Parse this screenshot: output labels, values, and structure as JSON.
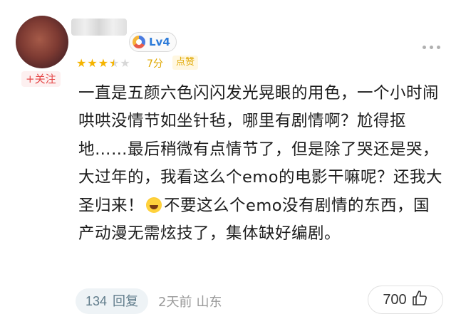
{
  "user": {
    "follow_label": "+关注",
    "level": "Lv4"
  },
  "rating": {
    "stars": 3.5,
    "max_stars": 5,
    "score": "7分",
    "rate_label": "点赞"
  },
  "comment": {
    "text_before_emoji": "一直是五颜六色闪闪发光晃眼的用色，一个小时闹哄哄没情节如坐针毡，哪里有剧情啊？尬得抠地……最后稍微有点情节了，但是除了哭还是哭，大过年的，我看这么个emo的电影干嘛呢？还我大圣归来！",
    "emoji": "laughing-tears-emoji",
    "text_after_emoji": "不要这么个emo没有剧情的东西，国产动漫无需炫技了，集体缺好编剧。"
  },
  "footer": {
    "reply_count": "134",
    "reply_label": "回复",
    "time": "2天前",
    "location": "山东",
    "like_count": "700"
  },
  "colors": {
    "star": "#f5b400",
    "follow": "#e54848",
    "level": "#2d7bd9"
  }
}
